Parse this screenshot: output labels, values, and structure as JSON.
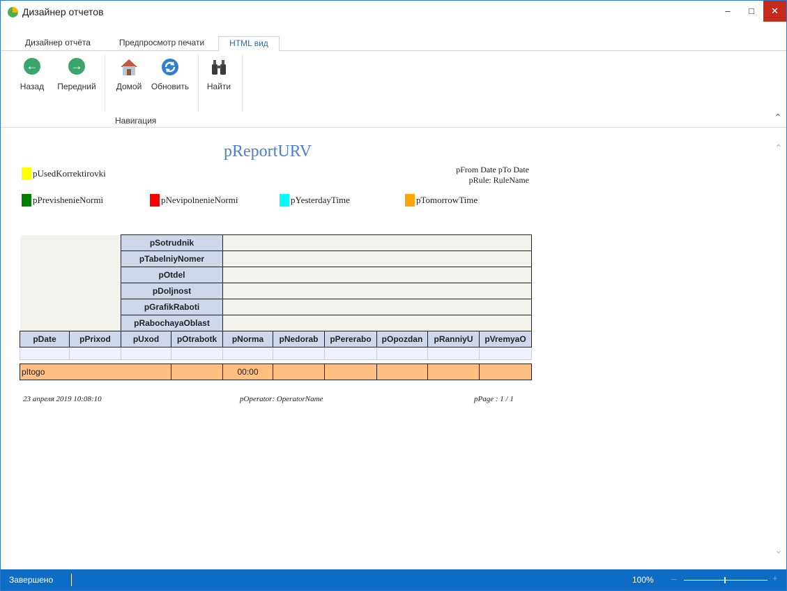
{
  "window": {
    "title": "Дизайнер отчетов"
  },
  "tabs": [
    {
      "label": "Дизайнер отчёта"
    },
    {
      "label": "Предпросмотр печати"
    },
    {
      "label": "HTML вид"
    }
  ],
  "ribbon": {
    "buttons": {
      "back": "Назад",
      "forward": "Передний",
      "home": "Домой",
      "refresh": "Обновить",
      "find": "Найти"
    },
    "group_label": "Навигация"
  },
  "report": {
    "title": "pReportURV",
    "date_range": "pFrom Date pTo Date",
    "rule": "pRule: RuleName",
    "legend": [
      {
        "label": "pUsedKorrektirovki",
        "color": "#ffff00"
      },
      {
        "label": "pPrevishenieNormi",
        "color": "#008000"
      },
      {
        "label": "pNevipolnenieNormi",
        "color": "#ff0000"
      },
      {
        "label": "pYesterdayTime",
        "color": "#00ffff"
      },
      {
        "label": "pTomorrowTime",
        "color": "#ffa500"
      }
    ],
    "info_labels": [
      "pSotrudnik",
      "pTabelniyNomer",
      "pOtdel",
      "pDoljnost",
      "pGrafikRaboti",
      "pRabochayaOblast"
    ],
    "columns": [
      "pDate",
      "pPrixod",
      "pUxod",
      "pOtrabotk",
      "pNorma",
      "pNedorab",
      "pPererabo",
      "pOpozdan",
      "pRanniyU",
      "pVremyaO"
    ],
    "total_label": "pItogo",
    "total_norma": "00:00",
    "footer": {
      "datetime": "23 апреля 2019 10:08:10",
      "operator": "pOperator: OperatorName",
      "page": "pPage : 1 / 1"
    }
  },
  "status": {
    "text": "Завершено",
    "zoom": "100%",
    "zoom_level": 0.5
  }
}
